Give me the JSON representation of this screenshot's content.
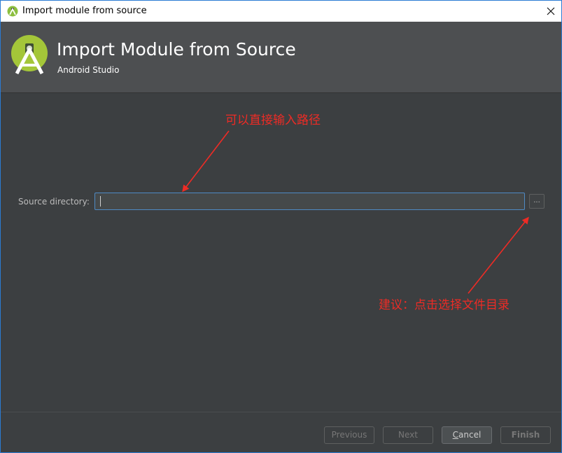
{
  "window": {
    "title": "Import module from source",
    "close_icon": "close-icon"
  },
  "header": {
    "title": "Import Module from Source",
    "subtitle": "Android Studio",
    "logo_icon": "android-studio-logo"
  },
  "form": {
    "source_label": "Source directory:",
    "source_value": "",
    "browse_label": "...",
    "browse_icon": "ellipsis-icon"
  },
  "annotations": {
    "input_hint": "可以直接输入路径",
    "browse_hint": "建议：点击选择文件目录",
    "color": "#ee2b25"
  },
  "footer": {
    "previous": "Previous",
    "next": "Next",
    "cancel_mnemonic": "C",
    "cancel_rest": "ancel",
    "finish": "Finish"
  },
  "colors": {
    "background": "#3c3f41",
    "header_bg": "#4d4f51",
    "accent_border": "#4f8ac4",
    "logo_green": "#a4c639"
  }
}
